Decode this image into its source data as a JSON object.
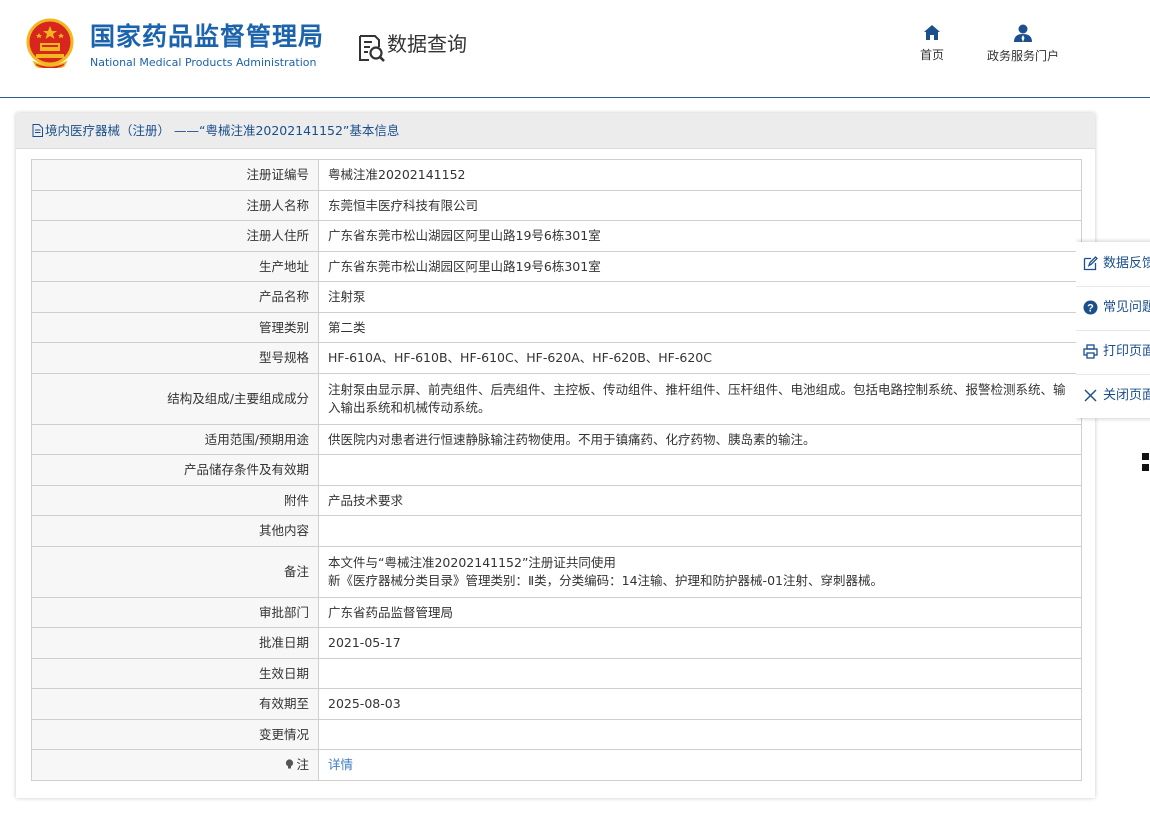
{
  "header": {
    "org_name_cn": "国家药品监督管理局",
    "org_name_en": "National Medical Products Administration",
    "section_title": "数据查询",
    "nav": [
      {
        "label": "首页",
        "icon": "home-icon"
      },
      {
        "label": "政务服务门户",
        "icon": "user-icon"
      }
    ]
  },
  "panel": {
    "title": "境内医疗器械（注册） ——“粤械注准20202141152”基本信息"
  },
  "table": {
    "rows": [
      {
        "key": "注册证编号",
        "value": "粤械注准20202141152"
      },
      {
        "key": "注册人名称",
        "value": "东莞恒丰医疗科技有限公司"
      },
      {
        "key": "注册人住所",
        "value": "广东省东莞市松山湖园区阿里山路19号6栋301室"
      },
      {
        "key": "生产地址",
        "value": "广东省东莞市松山湖园区阿里山路19号6栋301室"
      },
      {
        "key": "产品名称",
        "value": "注射泵"
      },
      {
        "key": "管理类别",
        "value": "第二类"
      },
      {
        "key": "型号规格",
        "value": "HF-610A、HF-610B、HF-610C、HF-620A、HF-620B、HF-620C"
      },
      {
        "key": "结构及组成/主要组成成分",
        "value": "注射泵由显示屏、前壳组件、后壳组件、主控板、传动组件、推杆组件、压杆组件、电池组成。包括电路控制系统、报警检测系统、输入输出系统和机械传动系统。"
      },
      {
        "key": "适用范围/预期用途",
        "value": "供医院内对患者进行恒速静脉输注药物使用。不用于镇痛药、化疗药物、胰岛素的输注。"
      },
      {
        "key": "产品储存条件及有效期",
        "value": ""
      },
      {
        "key": "附件",
        "value": "产品技术要求"
      },
      {
        "key": "其他内容",
        "value": ""
      },
      {
        "key": "备注",
        "value_line1": "本文件与“粤械注准20202141152”注册证共同使用",
        "value_line2": "新《医疗器械分类目录》管理类别：Ⅱ类，分类编码：14注输、护理和防护器械-01注射、穿刺器械。"
      },
      {
        "key": "审批部门",
        "value": "广东省药品监督管理局"
      },
      {
        "key": "批准日期",
        "value": "2021-05-17"
      },
      {
        "key": "生效日期",
        "value": ""
      },
      {
        "key": "有效期至",
        "value": "2025-08-03"
      },
      {
        "key": "变更情况",
        "value": ""
      },
      {
        "key": "注",
        "value": "详情",
        "key_icon": "lightbulb-icon"
      }
    ]
  },
  "side_menu": [
    {
      "label": "数据反馈",
      "icon": "edit-icon"
    },
    {
      "label": "常见问题",
      "icon": "question-icon"
    },
    {
      "label": "打印页面",
      "icon": "print-icon"
    },
    {
      "label": "关闭页面",
      "icon": "close-icon"
    }
  ],
  "colors": {
    "brand_blue": "#1c63ad",
    "link_blue": "#3f7ec1",
    "header_rule": "#2b5e96",
    "emblem_red": "#d7261d",
    "emblem_gold": "#f2b71e"
  }
}
